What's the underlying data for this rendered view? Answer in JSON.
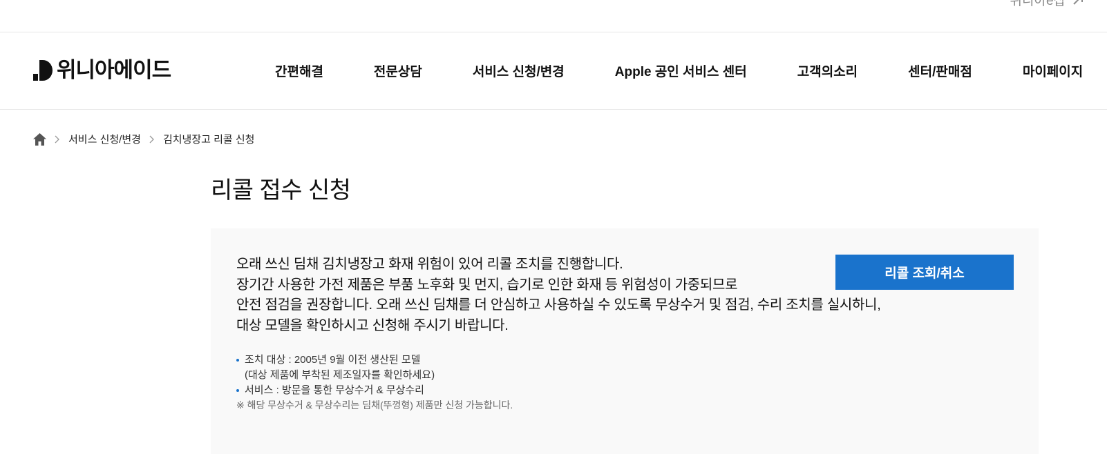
{
  "topbar": {
    "shop_link": "위니아e샵"
  },
  "header": {
    "logo_text": "위니아에이드",
    "nav": [
      "간편해결",
      "전문상담",
      "서비스 신청/변경",
      "Apple 공인 서비스 센터",
      "고객의소리",
      "센터/판매점",
      "마이페이지"
    ]
  },
  "breadcrumb": {
    "items": [
      "서비스 신청/변경",
      "김치냉장고 리콜 신청"
    ]
  },
  "page": {
    "title": "리콜 접수 신청"
  },
  "notice": {
    "intro_lines": [
      "오래 쓰신 딤채 김치냉장고 화재 위험이 있어 리콜 조치를 진행합니다.",
      "장기간 사용한 가전 제품은 부품 노후화 및 먼지, 습기로 인한 화재 등 위험성이 가중되므로",
      "안전 점검을 권장합니다. 오래 쓰신 딤채를 더 안심하고 사용하실 수 있도록 무상수거 및 점검, 수리 조치를 실시하니,",
      "대상 모델을 확인하시고 신청해 주시기 바랍니다."
    ],
    "button_label": "리콜 조회/취소",
    "bullet_target": "조치 대상 : 2005년 9월 이전 생산된 모델",
    "bullet_target_sub": "(대상 제품에 부착된 제조일자를 확인하세요)",
    "bullet_service": "서비스 : 방문을 통한 무상수거 & 무상수리",
    "footnote": "※ 해당 무상수거 & 무상수리는 딤채(뚜껑형) 제품만 신청 가능합니다."
  },
  "colors": {
    "accent": "#1a73cc",
    "box_bg": "#f9f9f9",
    "muted": "#8a8a8a"
  }
}
